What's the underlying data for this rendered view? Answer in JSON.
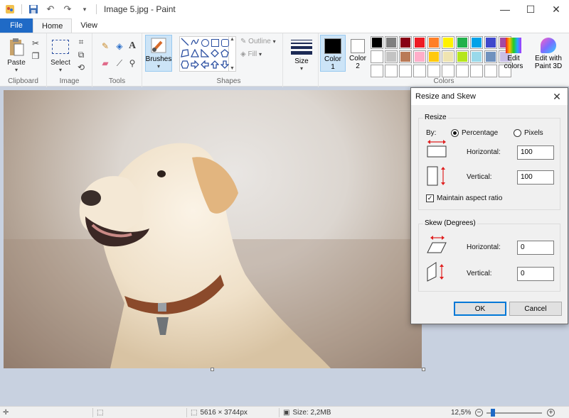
{
  "window": {
    "title": "Image 5.jpg - Paint",
    "controls": {
      "minimize": "—",
      "maximize": "☐",
      "close": "✕"
    }
  },
  "tabs": [
    {
      "label": "File"
    },
    {
      "label": "Home"
    },
    {
      "label": "View"
    }
  ],
  "ribbon": {
    "clipboard": {
      "paste_label": "Paste",
      "group_label": "Clipboard"
    },
    "image": {
      "select_label": "Select",
      "group_label": "Image"
    },
    "tools": {
      "group_label": "Tools"
    },
    "brushes": {
      "label": "Brushes"
    },
    "shapes": {
      "outline_label": "Outline",
      "fill_label": "Fill",
      "group_label": "Shapes"
    },
    "size": {
      "label": "Size"
    },
    "colors": {
      "color1_label": "Color\n1",
      "color2_label": "Color\n2",
      "color1_value": "#000000",
      "color2_value": "#ffffff",
      "edit_label": "Edit colors",
      "paint3d_label": "Edit with Paint 3D",
      "group_label": "Colors",
      "palette": [
        "#000000",
        "#7f7f7f",
        "#880015",
        "#ed1c24",
        "#ff7f27",
        "#fff200",
        "#22b14c",
        "#00a2e8",
        "#3f48cc",
        "#a349a4",
        "#ffffff",
        "#c3c3c3",
        "#b97a57",
        "#ffaec9",
        "#ffc90e",
        "#efe4b0",
        "#b5e61d",
        "#99d9ea",
        "#7092be",
        "#c8bfe7",
        "#ffffff",
        "#ffffff",
        "#ffffff",
        "#ffffff",
        "#ffffff",
        "#ffffff",
        "#ffffff",
        "#ffffff",
        "#ffffff",
        "#ffffff"
      ]
    }
  },
  "status": {
    "dimensions": "5616 × 3744px",
    "size": "Size: 2,2MB",
    "zoom": "12,5%",
    "zoom_minus": "−",
    "zoom_plus": "+",
    "zoom_fraction": 0.08
  },
  "dialog": {
    "title": "Resize and Skew",
    "close": "✕",
    "resize": {
      "legend": "Resize",
      "by_label": "By:",
      "percentage_label": "Percentage",
      "pixels_label": "Pixels",
      "selected": "Percentage",
      "horizontal_label": "Horizontal:",
      "horizontal_value": "100",
      "vertical_label": "Vertical:",
      "vertical_value": "100",
      "maintain_label": "Maintain aspect ratio",
      "maintain_checked": true
    },
    "skew": {
      "legend": "Skew (Degrees)",
      "horizontal_label": "Horizontal:",
      "horizontal_value": "0",
      "vertical_label": "Vertical:",
      "vertical_value": "0"
    },
    "ok_label": "OK",
    "cancel_label": "Cancel"
  }
}
